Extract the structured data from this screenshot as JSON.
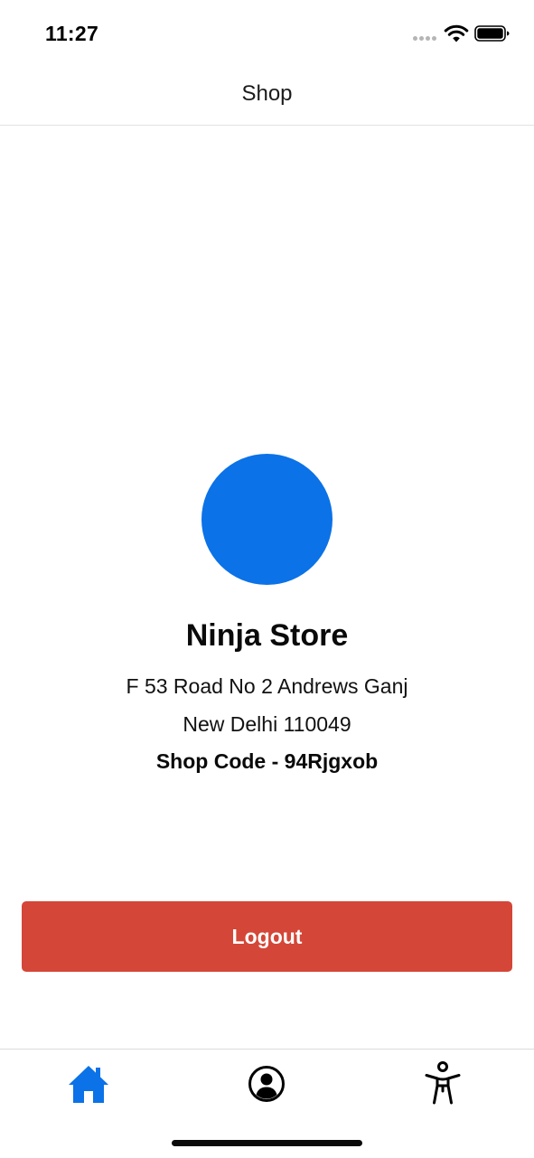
{
  "status_bar": {
    "time": "11:27"
  },
  "header": {
    "title": "Shop"
  },
  "store": {
    "name": "Ninja Store",
    "address_line_1": "F 53 Road No 2 Andrews Ganj",
    "address_line_2": "New Delhi 110049",
    "shop_code": "Shop Code - 94Rjgxob"
  },
  "actions": {
    "logout_label": "Logout"
  },
  "tab_bar": {
    "items": [
      {
        "icon": "home-icon",
        "active": true
      },
      {
        "icon": "profile-icon",
        "active": false
      },
      {
        "icon": "accessibility-icon",
        "active": false
      }
    ]
  },
  "colors": {
    "accent": "#0b72e7",
    "logout": "#d44637",
    "active_tab": "#0b72e7",
    "inactive_tab": "#000000"
  }
}
